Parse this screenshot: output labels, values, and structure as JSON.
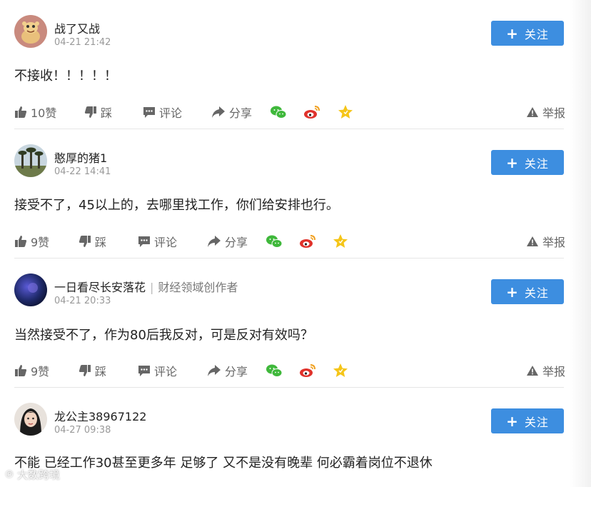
{
  "comments": [
    {
      "user_name": "战了又战",
      "user_tag": "",
      "timestamp": "04-21 21:42",
      "text": "不接收！！！！！",
      "likes_label": "10赞",
      "avatar": "cartoon-avatar"
    },
    {
      "user_name": "憨厚的猪1",
      "user_tag": "",
      "timestamp": "04-22 14:41",
      "text": "接受不了，45以上的，去哪里找工作，你们给安排也行。",
      "likes_label": "9赞",
      "avatar": "tree-avatar"
    },
    {
      "user_name": "一日看尽长安落花",
      "user_tag": "财经领域创作者",
      "timestamp": "04-21 20:33",
      "text": "当然接受不了，作为80后我反对，可是反对有效吗？",
      "likes_label": "9赞",
      "avatar": "dark-blue-avatar"
    },
    {
      "user_name": "龙公主38967122",
      "user_tag": "",
      "timestamp": "04-27 09:38",
      "text": "不能 已经工作30甚至更多年 足够了 又不是没有晚辈 何必霸着岗位不退休",
      "likes_label": "",
      "avatar": "portrait-avatar"
    }
  ],
  "labels": {
    "follow": "关注",
    "dislike": "踩",
    "comment": "评论",
    "share": "分享",
    "report": "举报"
  },
  "watermark": "大数跨境",
  "colors": {
    "accent": "#3d8ee0",
    "wechat": "#3fb83b",
    "weibo": "#e0322b",
    "star": "#f5c518",
    "icon_gray": "#666666"
  }
}
